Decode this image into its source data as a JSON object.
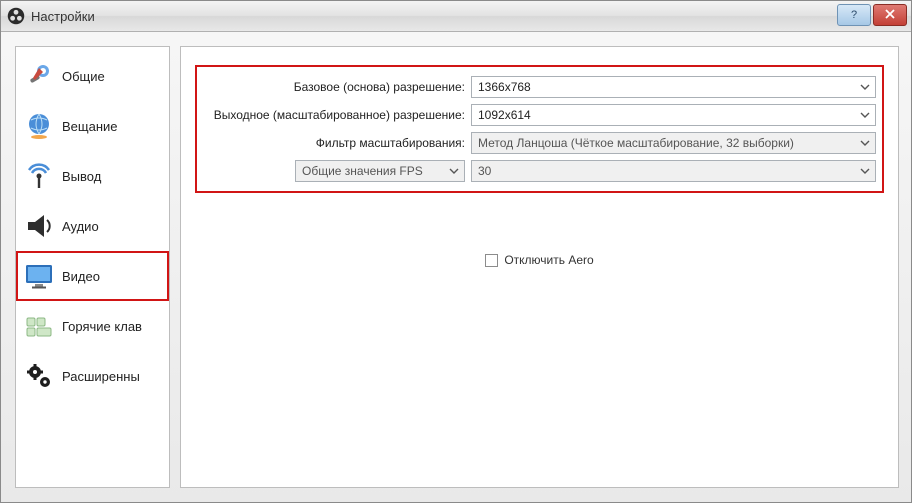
{
  "window": {
    "title": "Настройки"
  },
  "sidebar": {
    "items": [
      {
        "label": "Общие"
      },
      {
        "label": "Вещание"
      },
      {
        "label": "Вывод"
      },
      {
        "label": "Аудио"
      },
      {
        "label": "Видео"
      },
      {
        "label": "Горячие клав"
      },
      {
        "label": "Расширенны"
      }
    ]
  },
  "form": {
    "base_res_label": "Базовое (основа) разрешение:",
    "base_res_value": "1366x768",
    "out_res_label": "Выходное (масштабированное) разрешение:",
    "out_res_value": "1092x614",
    "filter_label": "Фильтр масштабирования:",
    "filter_value": "Метод Ланцоша (Чёткое масштабирование, 32 выборки)",
    "fps_type_value": "Общие значения FPS",
    "fps_value": "30",
    "aero_label": "Отключить Aero"
  }
}
